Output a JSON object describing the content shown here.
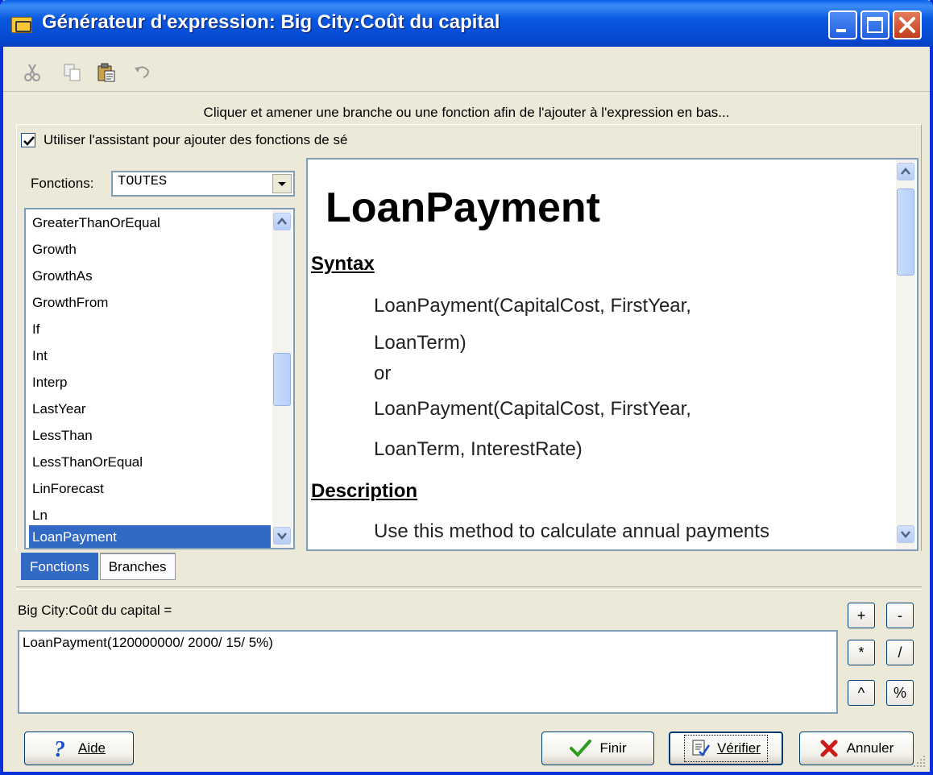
{
  "window": {
    "title": "Générateur d'expression: Big City:Coût du capital"
  },
  "toolbar": {
    "tools": [
      "scissors-icon",
      "copy-icon",
      "paste-icon",
      "undo-icon"
    ]
  },
  "instruction": "Cliquer et amener une branche ou une fonction afin de l'ajouter à l'expression en bas...",
  "wizard_checkbox": {
    "label": "Utiliser l'assistant pour ajouter des fonctions de sé",
    "checked": true
  },
  "functions": {
    "label": "Fonctions:",
    "filter_value": "TOUTES",
    "items": [
      "GreaterThanOrEqual",
      "Growth",
      "GrowthAs",
      "GrowthFrom",
      "If",
      "Int",
      "Interp",
      "LastYear",
      "LessThan",
      "LessThanOrEqual",
      "LinForecast",
      "Ln",
      "LoanPayment"
    ],
    "selected": "LoanPayment"
  },
  "help": {
    "title": "LoanPayment",
    "syntax_heading": "Syntax",
    "syntax_line1": "LoanPayment(CapitalCost, FirstYear,",
    "syntax_line2": "LoanTerm)",
    "syntax_or": "or",
    "syntax_line3": "LoanPayment(CapitalCost, FirstYear,",
    "syntax_line4": "LoanTerm, InterestRate)",
    "description_heading": "Description",
    "description_line1": "Use this method to calculate annual payments"
  },
  "tabs": [
    {
      "label": "Fonctions",
      "active": true
    },
    {
      "label": "Branches",
      "active": false
    }
  ],
  "expression": {
    "label": "Big City:Coût du capital =",
    "value": "LoanPayment(120000000/ 2000/ 15/ 5%)"
  },
  "operators": [
    "+",
    "-",
    "*",
    "/",
    "^",
    "%"
  ],
  "buttons": {
    "help": "Aide",
    "finish": "Finir",
    "verify": "Vérifier",
    "cancel": "Annuler"
  }
}
